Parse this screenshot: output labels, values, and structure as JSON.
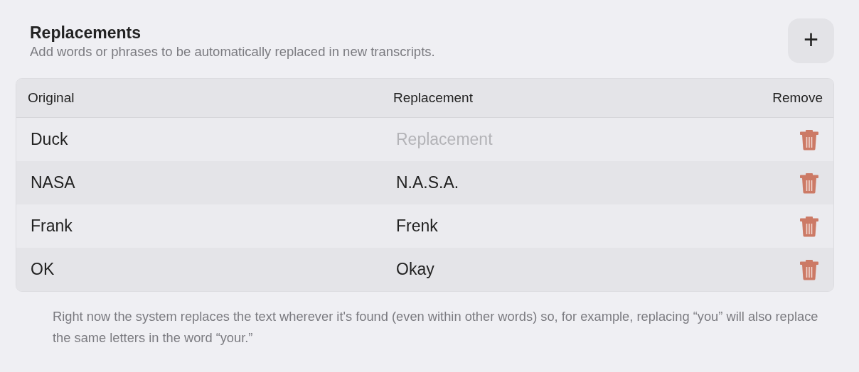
{
  "header": {
    "title": "Replacements",
    "subtitle": "Add words or phrases to be automatically replaced in new transcripts.",
    "add_button": "+"
  },
  "table": {
    "columns": [
      "Original",
      "Replacement",
      "Remove"
    ],
    "rows": [
      {
        "original": "Duck",
        "replacement": "",
        "placeholder": "Replacement"
      },
      {
        "original": "NASA",
        "replacement": "N.A.S.A."
      },
      {
        "original": "Frank",
        "replacement": "Frenk"
      },
      {
        "original": "OK",
        "replacement": "Okay"
      }
    ]
  },
  "note": "Right now the system replaces the text wherever it's found (even within other words) so, for example, replacing “you” will also replace the same letters in the word “your.”"
}
